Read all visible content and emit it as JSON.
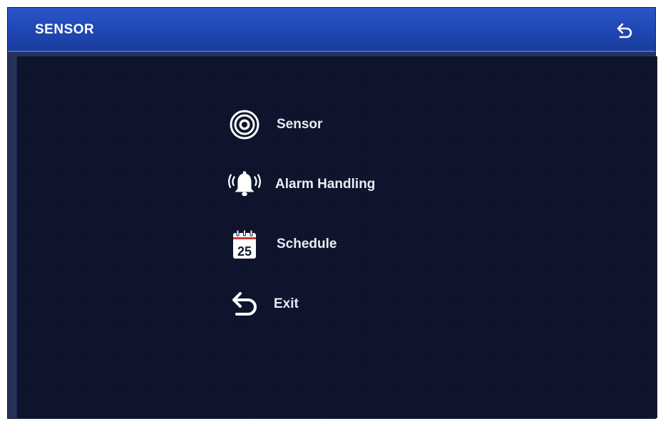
{
  "window": {
    "title": "SENSOR",
    "back_icon": "back-arrow-icon"
  },
  "menu": {
    "items": [
      {
        "label": "Sensor",
        "icon": "sensor-icon"
      },
      {
        "label": "Alarm Handling",
        "icon": "alarm-bell-icon"
      },
      {
        "label": "Schedule",
        "icon": "calendar-icon",
        "icon_text": "25"
      },
      {
        "label": "Exit",
        "icon": "exit-arrow-icon"
      }
    ]
  },
  "colors": {
    "titlebar": "#1f47b3",
    "content_bg": "#0a1129",
    "frame": "#25325a",
    "text": "#e8ecf6"
  }
}
